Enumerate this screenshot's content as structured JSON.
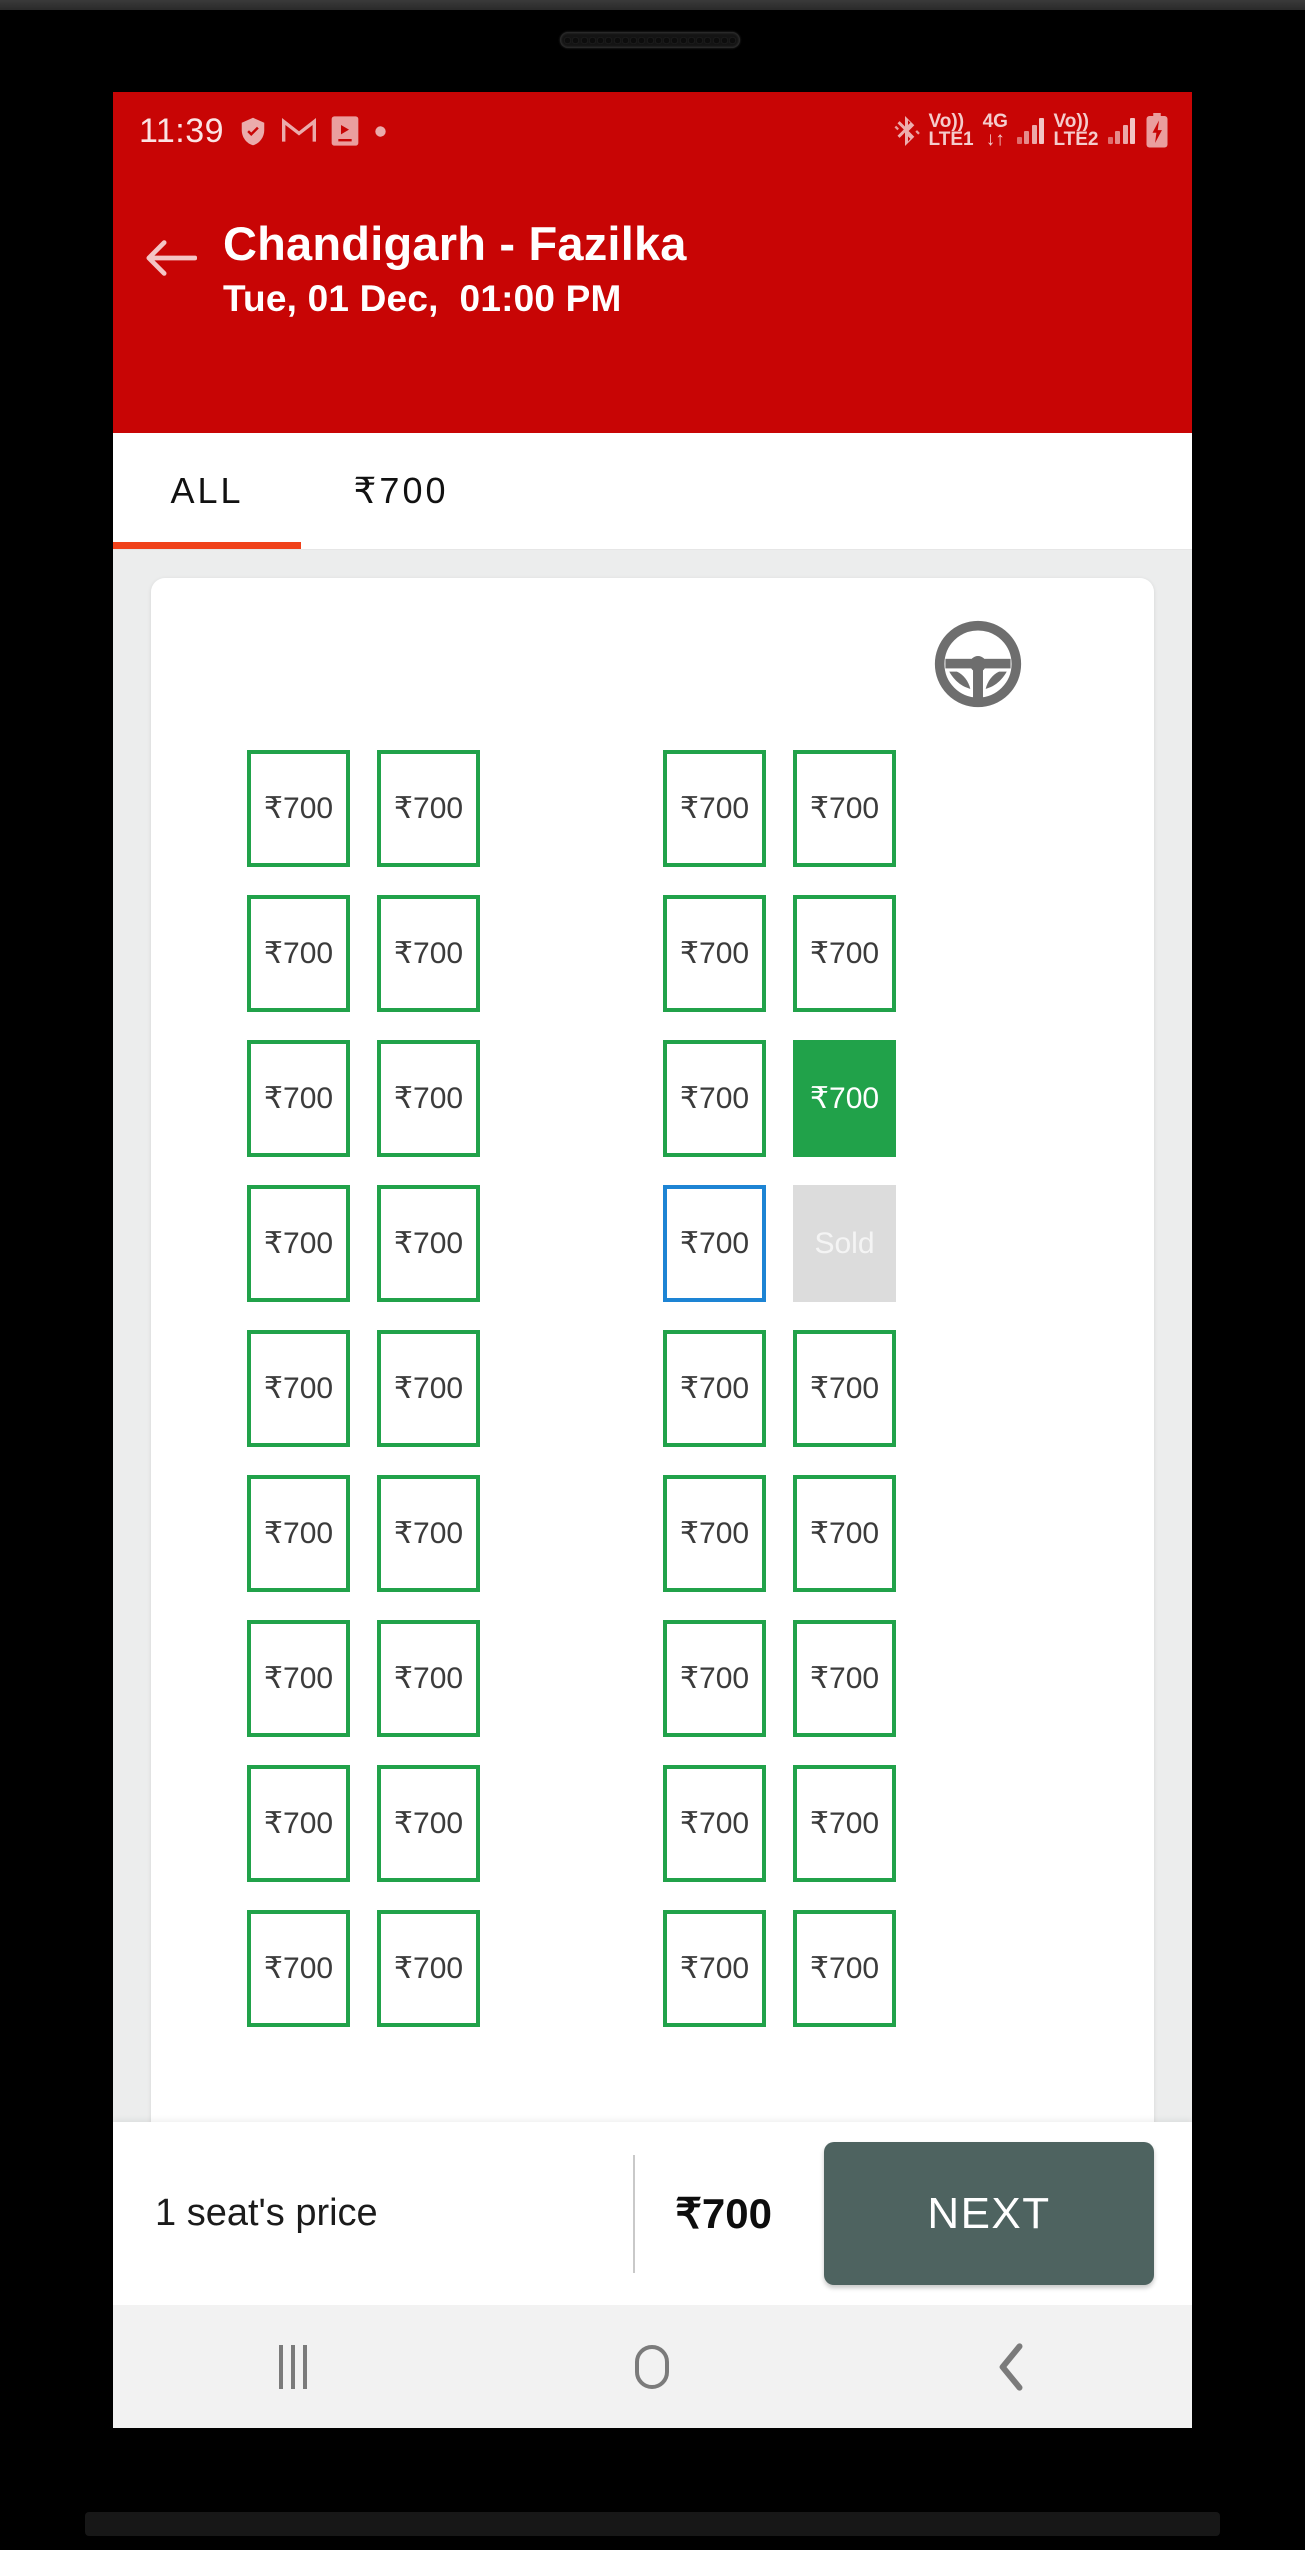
{
  "status_bar": {
    "time": "11:39",
    "left_icons": [
      "shield-check-icon",
      "gmail-icon",
      "screen-record-icon",
      "dot-icon"
    ],
    "bluetooth": "bluetooth-icon",
    "volte1_line1": "Vo))",
    "volte1_line2": "LTE1",
    "network_type": "4G",
    "data_arrows": "↓↑",
    "volte2_line1": "Vo))",
    "volte2_line2": "LTE2",
    "battery": "battery-charging-icon"
  },
  "app_bar": {
    "back_icon": "back-arrow-icon",
    "route_title": "Chandigarh - Fazilka",
    "trip_datetime": "Tue, 01 Dec,  01:00 PM",
    "background_color": "#C80505"
  },
  "tabs": {
    "items": [
      {
        "label": "ALL",
        "active": true
      },
      {
        "label": "₹700",
        "active": false
      }
    ],
    "active_indicator_color": "#F0411A"
  },
  "bus_layout": {
    "driver_icon": "steering-wheel-icon",
    "legend_colors": {
      "available": "#21A24A",
      "selected": "#21A24A",
      "ladies": "#1D84D4",
      "sold": "#DCDCDC"
    },
    "seat_price_label": "₹700",
    "sold_label": "Sold",
    "rows": [
      {
        "seats": [
          {
            "label": "₹700",
            "state": "available"
          },
          {
            "label": "₹700",
            "state": "available"
          },
          {
            "label": "₹700",
            "state": "available"
          },
          {
            "label": "₹700",
            "state": "available"
          }
        ]
      },
      {
        "seats": [
          {
            "label": "₹700",
            "state": "available"
          },
          {
            "label": "₹700",
            "state": "available"
          },
          {
            "label": "₹700",
            "state": "available"
          },
          {
            "label": "₹700",
            "state": "available"
          }
        ]
      },
      {
        "seats": [
          {
            "label": "₹700",
            "state": "available"
          },
          {
            "label": "₹700",
            "state": "available"
          },
          {
            "label": "₹700",
            "state": "available"
          },
          {
            "label": "₹700",
            "state": "selected"
          }
        ]
      },
      {
        "seats": [
          {
            "label": "₹700",
            "state": "available"
          },
          {
            "label": "₹700",
            "state": "available"
          },
          {
            "label": "₹700",
            "state": "ladies"
          },
          {
            "label": "Sold",
            "state": "sold"
          }
        ]
      },
      {
        "seats": [
          {
            "label": "₹700",
            "state": "available"
          },
          {
            "label": "₹700",
            "state": "available"
          },
          {
            "label": "₹700",
            "state": "available"
          },
          {
            "label": "₹700",
            "state": "available"
          }
        ]
      },
      {
        "seats": [
          {
            "label": "₹700",
            "state": "available"
          },
          {
            "label": "₹700",
            "state": "available"
          },
          {
            "label": "₹700",
            "state": "available"
          },
          {
            "label": "₹700",
            "state": "available"
          }
        ]
      },
      {
        "seats": [
          {
            "label": "₹700",
            "state": "available"
          },
          {
            "label": "₹700",
            "state": "available"
          },
          {
            "label": "₹700",
            "state": "available"
          },
          {
            "label": "₹700",
            "state": "available"
          }
        ]
      },
      {
        "seats": [
          {
            "label": "₹700",
            "state": "available"
          },
          {
            "label": "₹700",
            "state": "available"
          },
          {
            "label": "₹700",
            "state": "available"
          },
          {
            "label": "₹700",
            "state": "available"
          }
        ]
      },
      {
        "seats": [
          {
            "label": "₹700",
            "state": "available"
          },
          {
            "label": "₹700",
            "state": "available"
          },
          {
            "label": "₹700",
            "state": "available"
          },
          {
            "label": "₹700",
            "state": "available"
          }
        ]
      }
    ]
  },
  "bottom_bar": {
    "seat_count_label": "1 seat's price",
    "total_price": "₹700",
    "next_label": "NEXT",
    "next_color": "#4E6360"
  },
  "android_nav": {
    "recents": "recents-icon",
    "home": "home-icon",
    "back": "back-chevron-icon"
  }
}
